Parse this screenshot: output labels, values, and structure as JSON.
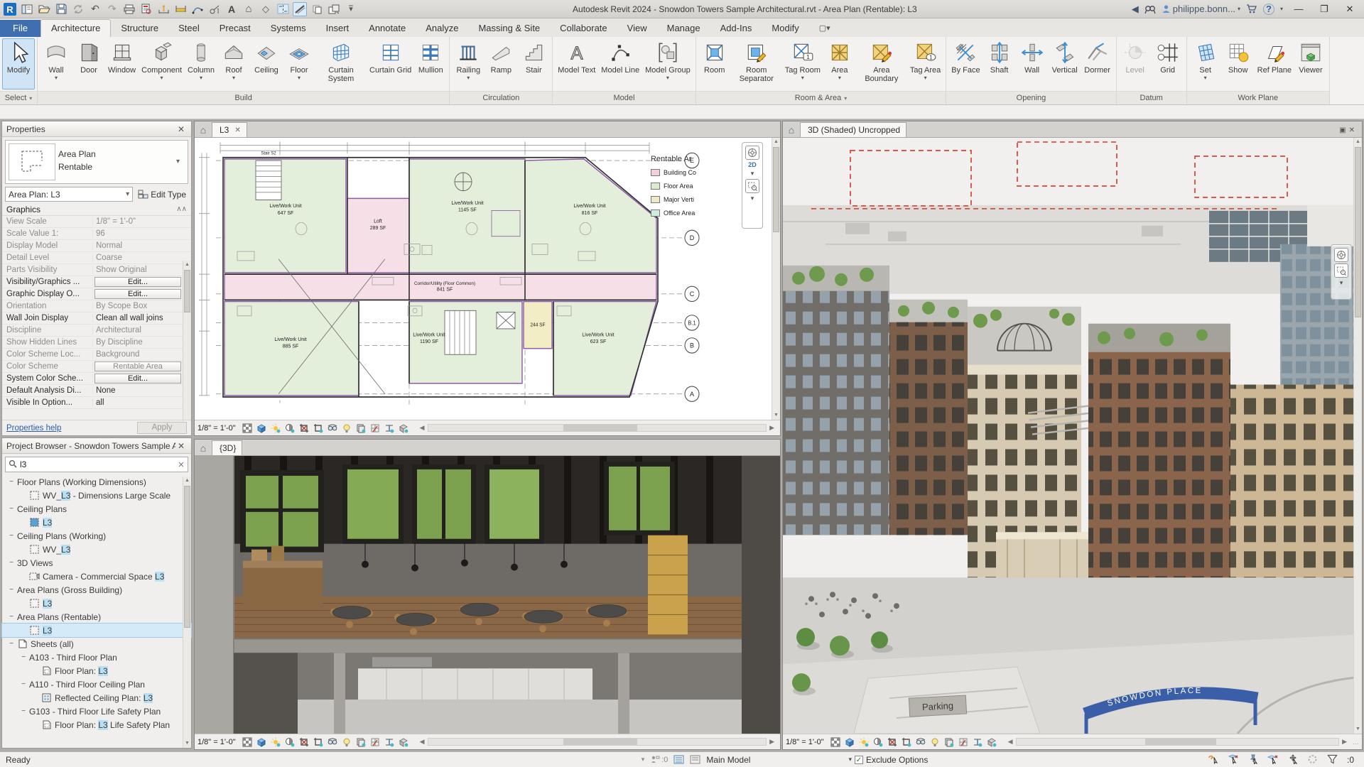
{
  "title_bar": {
    "title": "Autodesk Revit 2024 - Snowdon Towers Sample Architectural.rvt - Area Plan (Rentable): L3",
    "user": "philippe.bonn...",
    "qat": [
      "revit-logo",
      "file-tabs",
      "open",
      "save",
      "sync",
      "undo",
      "redo",
      "print",
      "print-preview",
      "measure",
      "dimension",
      "spline",
      "tag",
      "text",
      "home",
      "render",
      "section",
      "thin-lines",
      "copy",
      "switch-windows",
      "customize"
    ],
    "help": "?"
  },
  "ribbon": {
    "file_tab": "File",
    "tabs": [
      "Architecture",
      "Structure",
      "Steel",
      "Precast",
      "Systems",
      "Insert",
      "Annotate",
      "Analyze",
      "Massing & Site",
      "Collaborate",
      "View",
      "Manage",
      "Add-Ins",
      "Modify"
    ],
    "active_tab": "Architecture",
    "panels": [
      {
        "label": "Select",
        "arrow": true,
        "tools": [
          {
            "label": "Modify",
            "icon": "pointer",
            "active": true
          }
        ]
      },
      {
        "label": "Build",
        "tools": [
          {
            "label": "Wall",
            "icon": "wall",
            "arrow": true
          },
          {
            "label": "Door",
            "icon": "door"
          },
          {
            "label": "Window",
            "icon": "window"
          },
          {
            "label": "Component",
            "icon": "component",
            "arrow": true
          },
          {
            "label": "Column",
            "icon": "column",
            "arrow": true
          },
          {
            "label": "Roof",
            "icon": "roof",
            "arrow": true
          },
          {
            "label": "Ceiling",
            "icon": "ceiling"
          },
          {
            "label": "Floor",
            "icon": "floor",
            "arrow": true
          },
          {
            "label": "Curtain System",
            "icon": "curtain-system"
          },
          {
            "label": "Curtain Grid",
            "icon": "curtain-grid"
          },
          {
            "label": "Mullion",
            "icon": "mullion"
          }
        ]
      },
      {
        "label": "Circulation",
        "tools": [
          {
            "label": "Railing",
            "icon": "railing",
            "arrow": true
          },
          {
            "label": "Ramp",
            "icon": "ramp"
          },
          {
            "label": "Stair",
            "icon": "stair"
          }
        ]
      },
      {
        "label": "Model",
        "tools": [
          {
            "label": "Model Text",
            "icon": "model-text"
          },
          {
            "label": "Model Line",
            "icon": "model-line"
          },
          {
            "label": "Model Group",
            "icon": "model-group",
            "arrow": true
          }
        ]
      },
      {
        "label": "Room & Area",
        "arrow": true,
        "tools": [
          {
            "label": "Room",
            "icon": "room"
          },
          {
            "label": "Room Separator",
            "icon": "room-separator"
          },
          {
            "label": "Tag Room",
            "icon": "tag-room",
            "arrow": true
          },
          {
            "label": "Area",
            "icon": "area",
            "arrow": true
          },
          {
            "label": "Area Boundary",
            "icon": "area-boundary"
          },
          {
            "label": "Tag Area",
            "icon": "tag-area",
            "arrow": true
          }
        ]
      },
      {
        "label": "Opening",
        "tools": [
          {
            "label": "By Face",
            "icon": "by-face"
          },
          {
            "label": "Shaft",
            "icon": "shaft"
          },
          {
            "label": "Wall",
            "icon": "wall-opening"
          },
          {
            "label": "Vertical",
            "icon": "vertical-opening"
          },
          {
            "label": "Dormer",
            "icon": "dormer"
          }
        ]
      },
      {
        "label": "Datum",
        "tools": [
          {
            "label": "Level",
            "icon": "level",
            "disabled": true
          },
          {
            "label": "Grid",
            "icon": "grid"
          }
        ]
      },
      {
        "label": "Work Plane",
        "tools": [
          {
            "label": "Set",
            "icon": "set",
            "arrow": true
          },
          {
            "label": "Show",
            "icon": "show"
          },
          {
            "label": "Ref Plane",
            "icon": "ref-plane"
          },
          {
            "label": "Viewer",
            "icon": "viewer"
          }
        ]
      }
    ]
  },
  "properties": {
    "header": "Properties",
    "type_name": "Area Plan",
    "type_family": "Rentable",
    "instance": "Area Plan: L3",
    "edit_type": "Edit Type",
    "section": "Graphics",
    "rows": [
      {
        "label": "View Scale",
        "value": "1/8\" = 1'-0\"",
        "dim": true
      },
      {
        "label": "Scale Value    1:",
        "value": "96",
        "dim": true
      },
      {
        "label": "Display Model",
        "value": "Normal",
        "dim": true
      },
      {
        "label": "Detail Level",
        "value": "Coarse",
        "dim": true
      },
      {
        "label": "Parts Visibility",
        "value": "Show Original",
        "dim": true
      },
      {
        "label": "Visibility/Graphics ...",
        "value": "Edit...",
        "kind": "button"
      },
      {
        "label": "Graphic Display O...",
        "value": "Edit...",
        "kind": "button"
      },
      {
        "label": "Orientation",
        "value": "By Scope Box",
        "dim": true
      },
      {
        "label": "Wall Join Display",
        "value": "Clean all wall joins"
      },
      {
        "label": "Discipline",
        "value": "Architectural",
        "dim": true
      },
      {
        "label": "Show Hidden Lines",
        "value": "By Discipline",
        "dim": true
      },
      {
        "label": "Color Scheme Loc...",
        "value": "Background",
        "dim": true
      },
      {
        "label": "Color Scheme",
        "value": "Rentable Area",
        "kind": "button",
        "dim": true
      },
      {
        "label": "System Color Sche...",
        "value": "Edit...",
        "kind": "button"
      },
      {
        "label": "Default Analysis Di...",
        "value": "None"
      },
      {
        "label": "Visible In Option...",
        "value": "all"
      }
    ],
    "help_link": "Properties help",
    "apply_label": "Apply"
  },
  "project_browser": {
    "header": "Project Browser - Snowdon Towers Sample A...",
    "search": "l3",
    "tree": [
      {
        "label": "Floor Plans (Working Dimensions)",
        "level": 0,
        "expander": true
      },
      {
        "label": "WV_L3 - Dimensions Large Scale",
        "level": 1,
        "icon": "plan"
      },
      {
        "label": "Ceiling Plans",
        "level": 0,
        "expander": true
      },
      {
        "label": "L3",
        "level": 1,
        "icon": "ceiling"
      },
      {
        "label": "Ceiling Plans (Working)",
        "level": 0,
        "expander": true
      },
      {
        "label": "WV_L3",
        "level": 1,
        "icon": "plan"
      },
      {
        "label": "3D Views",
        "level": 0,
        "expander": true
      },
      {
        "label": "Camera - Commercial Space L3",
        "level": 1,
        "icon": "camera"
      },
      {
        "label": "Area Plans (Gross Building)",
        "level": 0,
        "expander": true
      },
      {
        "label": "L3",
        "level": 1,
        "icon": "plan"
      },
      {
        "label": "Area Plans (Rentable)",
        "level": 0,
        "expander": true
      },
      {
        "label": "L3",
        "level": 1,
        "icon": "plan",
        "selected": true
      },
      {
        "label": "Sheets (all)",
        "level": 0,
        "expander": true,
        "icon": "sheet"
      },
      {
        "label": "A103 - Third Floor Plan",
        "level": 1,
        "expander": true
      },
      {
        "label": "Floor Plan: L3",
        "level": 2,
        "icon": "sheetview"
      },
      {
        "label": "A110 - Third Floor Ceiling Plan",
        "level": 1,
        "expander": true
      },
      {
        "label": "Reflected Ceiling Plan: L3",
        "level": 2,
        "icon": "sheetrcp"
      },
      {
        "label": "G103 - Third Floor Life Safety Plan",
        "level": 1,
        "expander": true
      },
      {
        "label": "Floor Plan: L3 Life Safety Plan",
        "level": 2,
        "icon": "sheetview"
      }
    ]
  },
  "viewports": {
    "plan": {
      "tab": "L3",
      "scale": "1/8\" = 1'-0\"",
      "legend_title": "Rentable Ar",
      "legend": [
        {
          "label": "Building Co",
          "color": "#f4cfda"
        },
        {
          "label": "Floor Area",
          "color": "#dcecd2"
        },
        {
          "label": "Major Verti",
          "color": "#efe9c6"
        },
        {
          "label": "Office Area",
          "color": "#cfecdf"
        }
      ],
      "grids": [
        "E",
        "D",
        "C",
        "B.1",
        "B",
        "A"
      ],
      "stair_label": "Stair S2",
      "nav_2d": "2D",
      "rooms": [
        {
          "name": "Live/Work Unit",
          "area": "647 SF"
        },
        {
          "name": "Live/Work Unit",
          "area": "1145 SF"
        },
        {
          "name": "Live/Work Unit",
          "area": "816 SF"
        },
        {
          "name": "Loft",
          "area": "289 SF"
        },
        {
          "name": "Corridor/Utility (Floor Common)",
          "area": "841 SF"
        },
        {
          "name": "Live/Work Unit",
          "area": "885 SF"
        },
        {
          "name": "Live/Work Unit",
          "area": "1190 SF"
        },
        {
          "name": "Live/Work Unit",
          "area": "623 SF"
        },
        {
          "name": "",
          "area": "244 SF"
        }
      ]
    },
    "three_d": {
      "tab": "{3D}",
      "scale": "1/8\" = 1'-0\""
    },
    "shaded": {
      "tab": "3D (Shaded) Uncropped",
      "scale": "1/8\" = 1'-0\"",
      "arch_sign": "SNOWDON  PLACE",
      "parking_sign": "Parking"
    }
  },
  "vcb_icons": [
    "detail-level",
    "visual-style",
    "sun-path",
    "shadows",
    "crop-view",
    "show-crop",
    "temporary-hide",
    "reveal-hidden",
    "temporary-view-properties",
    "analytical-model",
    "reveal-constraints",
    "worksharing-display"
  ],
  "status_bar": {
    "ready": "Ready",
    "workset_badge": ":0",
    "main_model": "Main Model",
    "exclude_options": "Exclude Options",
    "check": "✓",
    "filter_badge": ":0",
    "right_icons": [
      "select-links",
      "select-underlay",
      "select-pinned",
      "select-by-face",
      "drag-on-selection",
      "selection-ring",
      "filter"
    ]
  },
  "colors": {
    "accent_blue": "#3f6fae",
    "room_green": "#e3efda",
    "corridor_pink": "#f6dfe7",
    "area_yellow": "#f3edc6",
    "boundary_purple": "#8c5ba6"
  }
}
